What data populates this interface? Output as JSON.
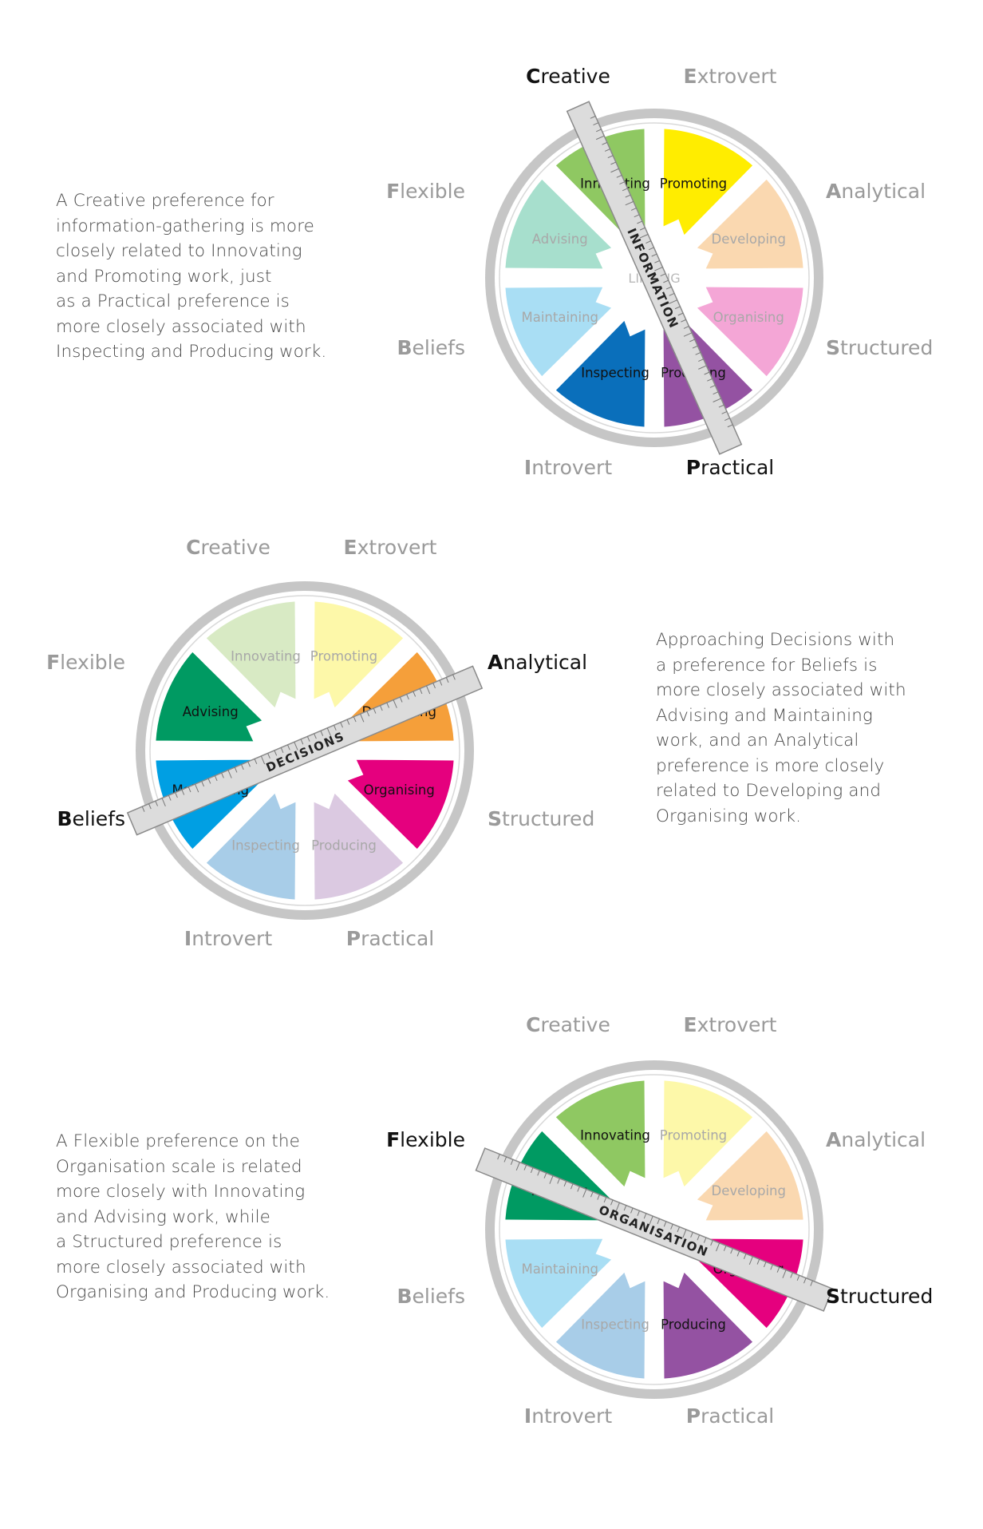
{
  "paragraphs": [
    {
      "lines": [
        "A Creative preference for",
        "information-gathering is more",
        "closely related to Innovating",
        "and Promoting work, just",
        "as a Practical preference is",
        "more closely associated with",
        "Inspecting and Producing work."
      ]
    },
    {
      "lines": [
        "Approaching Decisions with",
        "a preference for Beliefs is",
        "more closely associated with",
        "Advising and Maintaining",
        "work, and an Analytical",
        "preference is more closely",
        "related to Developing and",
        "Organising work."
      ]
    },
    {
      "lines": [
        "A Flexible preference on the",
        "Organisation scale is related",
        "more closely with Innovating",
        "and Advising work, while",
        "a Structured preference is",
        "more closely associated with",
        "Organising and Producing work."
      ]
    }
  ],
  "wheels": [
    {
      "bar_label": "INFORMATION",
      "center_text": "LINKING",
      "outer_labels": {
        "creative": "Creative",
        "extrovert": "Extrovert",
        "analytical": "Analytical",
        "structured": "Structured",
        "practical": "Practical",
        "introvert": "Introvert",
        "beliefs": "Beliefs",
        "flexible": "Flexible"
      },
      "highlighted_labels": [
        "creative",
        "practical"
      ],
      "sectors": [
        {
          "key": "promoting",
          "label": "Promoting",
          "color": "#ffed00",
          "active": true
        },
        {
          "key": "developing",
          "label": "Developing",
          "color": "#fad8b0",
          "active": false
        },
        {
          "key": "organising",
          "label": "Organising",
          "color": "#f4a6d6",
          "active": false
        },
        {
          "key": "producing",
          "label": "Producing",
          "color": "#9452a2",
          "active": true
        },
        {
          "key": "inspecting",
          "label": "Inspecting",
          "color": "#0a6fbb",
          "active": true
        },
        {
          "key": "maintaining",
          "label": "Maintaining",
          "color": "#a9def4",
          "active": false
        },
        {
          "key": "advising",
          "label": "Advising",
          "color": "#a7dfcd",
          "active": false
        },
        {
          "key": "innovating",
          "label": "Innovating",
          "color": "#8fc862",
          "active": true
        }
      ]
    },
    {
      "bar_label": "DECISIONS",
      "center_text": "",
      "outer_labels": {
        "creative": "Creative",
        "extrovert": "Extrovert",
        "analytical": "Analytical",
        "structured": "Structured",
        "practical": "Practical",
        "introvert": "Introvert",
        "beliefs": "Beliefs",
        "flexible": "Flexible"
      },
      "highlighted_labels": [
        "analytical",
        "beliefs"
      ],
      "sectors": [
        {
          "key": "promoting",
          "label": "Promoting",
          "color": "#fdf8a9",
          "active": false
        },
        {
          "key": "developing",
          "label": "Developing",
          "color": "#f59f3a",
          "active": true
        },
        {
          "key": "organising",
          "label": "Organising",
          "color": "#e5007e",
          "active": true
        },
        {
          "key": "producing",
          "label": "Producing",
          "color": "#dbc9e1",
          "active": false
        },
        {
          "key": "inspecting",
          "label": "Inspecting",
          "color": "#a8cde8",
          "active": false
        },
        {
          "key": "maintaining",
          "label": "Maintaining",
          "color": "#009fe3",
          "active": true
        },
        {
          "key": "advising",
          "label": "Advising",
          "color": "#009a62",
          "active": true
        },
        {
          "key": "innovating",
          "label": "Innovating",
          "color": "#d8eac4",
          "active": false
        }
      ]
    },
    {
      "bar_label": "ORGANISATION",
      "center_text": "",
      "outer_labels": {
        "creative": "Creative",
        "extrovert": "Extrovert",
        "analytical": "Analytical",
        "structured": "Structured",
        "practical": "Practical",
        "introvert": "Introvert",
        "beliefs": "Beliefs",
        "flexible": "Flexible"
      },
      "highlighted_labels": [
        "flexible",
        "structured"
      ],
      "sectors": [
        {
          "key": "promoting",
          "label": "Promoting",
          "color": "#fdf8a9",
          "active": false
        },
        {
          "key": "developing",
          "label": "Developing",
          "color": "#fad8b0",
          "active": false
        },
        {
          "key": "organising",
          "label": "Organising",
          "color": "#e5007e",
          "active": true
        },
        {
          "key": "producing",
          "label": "Producing",
          "color": "#9452a2",
          "active": true
        },
        {
          "key": "inspecting",
          "label": "Inspecting",
          "color": "#a8cde8",
          "active": false
        },
        {
          "key": "maintaining",
          "label": "Maintaining",
          "color": "#a9def4",
          "active": false
        },
        {
          "key": "advising",
          "label": "Advising",
          "color": "#009a62",
          "active": true
        },
        {
          "key": "innovating",
          "label": "Innovating",
          "color": "#8fc862",
          "active": true
        }
      ]
    }
  ]
}
